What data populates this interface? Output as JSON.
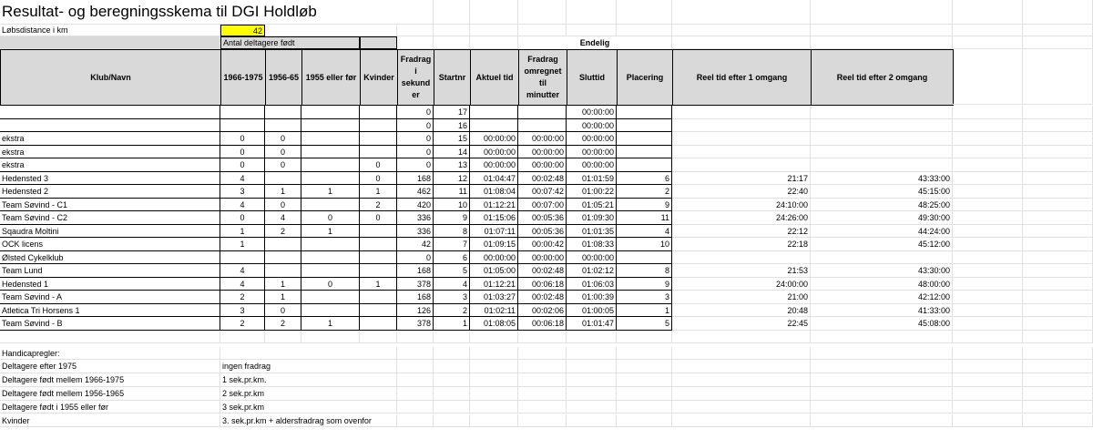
{
  "title": "Resultat- og beregningsskema til DGI Holdløb",
  "distance_label": "Løbsdistance i km",
  "distance_value": "42",
  "group_header": "Antal deltagere født",
  "final_header": "Endelig",
  "headers": {
    "klub": "Klub/Navn",
    "y1966": "1966-1975",
    "y1956": "1956-65",
    "y1955": "1955 eller før",
    "kvinder": "Kvinder",
    "fradrag_sek": "Fradrag i sekund er",
    "startnr": "Startnr",
    "aktuel": "Aktuel tid",
    "fradrag_min": "Fradrag omregnet til minutter",
    "sluttid": "Sluttid",
    "placering": "Placering",
    "reel1": "Reel tid efter 1 omgang",
    "reel2": "Reel tid efter 2 omgang"
  },
  "rows": [
    {
      "name": "",
      "a": "",
      "b": "",
      "c": "",
      "k": "",
      "fs": "0",
      "nr": "17",
      "akt": "",
      "fm": "",
      "slut": "00:00:00",
      "pl": "",
      "r1": "",
      "r2": ""
    },
    {
      "name": "",
      "a": "",
      "b": "",
      "c": "",
      "k": "",
      "fs": "0",
      "nr": "16",
      "akt": "",
      "fm": "",
      "slut": "00:00:00",
      "pl": "",
      "r1": "",
      "r2": ""
    },
    {
      "name": "ekstra",
      "a": "0",
      "b": "0",
      "c": "",
      "k": "",
      "fs": "0",
      "nr": "15",
      "akt": "00:00:00",
      "fm": "00:00:00",
      "slut": "00:00:00",
      "pl": "",
      "r1": "",
      "r2": ""
    },
    {
      "name": "ekstra",
      "a": "0",
      "b": "0",
      "c": "",
      "k": "",
      "fs": "0",
      "nr": "14",
      "akt": "00:00:00",
      "fm": "00:00:00",
      "slut": "00:00:00",
      "pl": "",
      "r1": "",
      "r2": ""
    },
    {
      "name": "ekstra",
      "a": "0",
      "b": "0",
      "c": "",
      "k": "0",
      "fs": "0",
      "nr": "13",
      "akt": "00:00:00",
      "fm": "00:00:00",
      "slut": "00:00:00",
      "pl": "",
      "r1": "",
      "r2": ""
    },
    {
      "name": "Hedensted 3",
      "a": "4",
      "b": "",
      "c": "",
      "k": "0",
      "fs": "168",
      "nr": "12",
      "akt": "01:04:47",
      "fm": "00:02:48",
      "slut": "01:01:59",
      "pl": "6",
      "r1": "21:17",
      "r2": "43:33:00"
    },
    {
      "name": "Hedensted 2",
      "a": "3",
      "b": "1",
      "c": "1",
      "k": "1",
      "fs": "462",
      "nr": "11",
      "akt": "01:08:04",
      "fm": "00:07:42",
      "slut": "01:00:22",
      "pl": "2",
      "r1": "22:40",
      "r2": "45:15:00"
    },
    {
      "name": "Team Søvind - C1",
      "a": "4",
      "b": "0",
      "c": "",
      "k": "2",
      "fs": "420",
      "nr": "10",
      "akt": "01:12:21",
      "fm": "00:07:00",
      "slut": "01:05:21",
      "pl": "9",
      "r1": "24:10:00",
      "r2": "48:25:00"
    },
    {
      "name": "Team Søvind - C2",
      "a": "0",
      "b": "4",
      "c": "0",
      "k": "0",
      "fs": "336",
      "nr": "9",
      "akt": "01:15:06",
      "fm": "00:05:36",
      "slut": "01:09:30",
      "pl": "11",
      "r1": "24:26:00",
      "r2": "49:30:00"
    },
    {
      "name": "Sqaudra Moltini",
      "a": "1",
      "b": "2",
      "c": "1",
      "k": "",
      "fs": "336",
      "nr": "8",
      "akt": "01:07:11",
      "fm": "00:05:36",
      "slut": "01:01:35",
      "pl": "4",
      "r1": "22:12",
      "r2": "44:24:00"
    },
    {
      "name": "OCK licens",
      "a": "1",
      "b": "",
      "c": "",
      "k": "",
      "fs": "42",
      "nr": "7",
      "akt": "01:09:15",
      "fm": "00:00:42",
      "slut": "01:08:33",
      "pl": "10",
      "r1": "22:18",
      "r2": "45:12:00"
    },
    {
      "name": "Ølsted Cykelklub",
      "a": "",
      "b": "",
      "c": "",
      "k": "",
      "fs": "0",
      "nr": "6",
      "akt": "00:00:00",
      "fm": "00:00:00",
      "slut": "00:00:00",
      "pl": "",
      "r1": "",
      "r2": ""
    },
    {
      "name": "Team Lund",
      "a": "4",
      "b": "",
      "c": "",
      "k": "",
      "fs": "168",
      "nr": "5",
      "akt": "01:05:00",
      "fm": "00:02:48",
      "slut": "01:02:12",
      "pl": "8",
      "r1": "21:53",
      "r2": "43:30:00"
    },
    {
      "name": "Hedensted 1",
      "a": "4",
      "b": "1",
      "c": "0",
      "k": "1",
      "fs": "378",
      "nr": "4",
      "akt": "01:12:21",
      "fm": "00:06:18",
      "slut": "01:06:03",
      "pl": "9",
      "r1": "24:00:00",
      "r2": "48:00:00"
    },
    {
      "name": "Team Søvind - A",
      "a": "2",
      "b": "1",
      "c": "",
      "k": "",
      "fs": "168",
      "nr": "3",
      "akt": "01:03:27",
      "fm": "00:02:48",
      "slut": "01:00:39",
      "pl": "3",
      "r1": "21:00",
      "r2": "42:12:00"
    },
    {
      "name": "Atletica Tri Horsens 1",
      "a": "3",
      "b": "0",
      "c": "",
      "k": "",
      "fs": "126",
      "nr": "2",
      "akt": "01:02:11",
      "fm": "00:02:06",
      "slut": "01:00:05",
      "pl": "1",
      "r1": "20:48",
      "r2": "41:33:00"
    },
    {
      "name": "Team Søvind - B",
      "a": "2",
      "b": "2",
      "c": "1",
      "k": "",
      "fs": "378",
      "nr": "1",
      "akt": "01:08:05",
      "fm": "00:06:18",
      "slut": "01:01:47",
      "pl": "5",
      "r1": "22:45",
      "r2": "45:08:00"
    }
  ],
  "rules_title": "Handicapregler:",
  "rules": [
    {
      "label": "Deltagere efter 1975",
      "value": "ingen fradrag"
    },
    {
      "label": "Deltagere født mellem 1966-1975",
      "value": "1 sek.pr.km."
    },
    {
      "label": "Deltagere født mellem 1956-1965",
      "value": "2 sek.pr.km"
    },
    {
      "label": "Deltagere født i 1955 eller før",
      "value": "3 sek.pr.km"
    },
    {
      "label": "Kvinder",
      "value": "3. sek.pr.km + aldersfradrag som ovenfor"
    }
  ]
}
